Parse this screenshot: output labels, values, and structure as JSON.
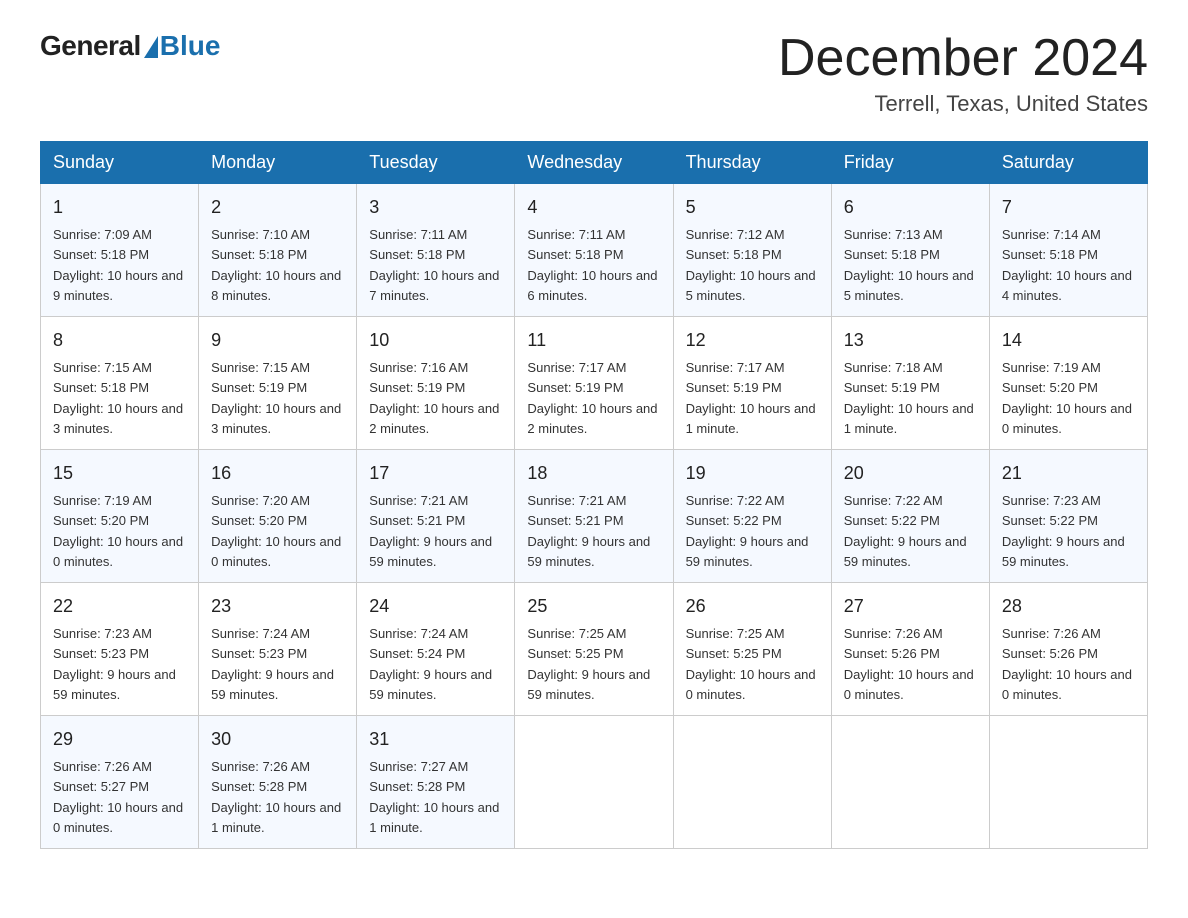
{
  "header": {
    "logo_general": "General",
    "logo_blue": "Blue",
    "month_title": "December 2024",
    "location": "Terrell, Texas, United States"
  },
  "weekdays": [
    "Sunday",
    "Monday",
    "Tuesday",
    "Wednesday",
    "Thursday",
    "Friday",
    "Saturday"
  ],
  "weeks": [
    [
      {
        "day": "1",
        "sunrise": "7:09 AM",
        "sunset": "5:18 PM",
        "daylight": "10 hours and 9 minutes."
      },
      {
        "day": "2",
        "sunrise": "7:10 AM",
        "sunset": "5:18 PM",
        "daylight": "10 hours and 8 minutes."
      },
      {
        "day": "3",
        "sunrise": "7:11 AM",
        "sunset": "5:18 PM",
        "daylight": "10 hours and 7 minutes."
      },
      {
        "day": "4",
        "sunrise": "7:11 AM",
        "sunset": "5:18 PM",
        "daylight": "10 hours and 6 minutes."
      },
      {
        "day": "5",
        "sunrise": "7:12 AM",
        "sunset": "5:18 PM",
        "daylight": "10 hours and 5 minutes."
      },
      {
        "day": "6",
        "sunrise": "7:13 AM",
        "sunset": "5:18 PM",
        "daylight": "10 hours and 5 minutes."
      },
      {
        "day": "7",
        "sunrise": "7:14 AM",
        "sunset": "5:18 PM",
        "daylight": "10 hours and 4 minutes."
      }
    ],
    [
      {
        "day": "8",
        "sunrise": "7:15 AM",
        "sunset": "5:18 PM",
        "daylight": "10 hours and 3 minutes."
      },
      {
        "day": "9",
        "sunrise": "7:15 AM",
        "sunset": "5:19 PM",
        "daylight": "10 hours and 3 minutes."
      },
      {
        "day": "10",
        "sunrise": "7:16 AM",
        "sunset": "5:19 PM",
        "daylight": "10 hours and 2 minutes."
      },
      {
        "day": "11",
        "sunrise": "7:17 AM",
        "sunset": "5:19 PM",
        "daylight": "10 hours and 2 minutes."
      },
      {
        "day": "12",
        "sunrise": "7:17 AM",
        "sunset": "5:19 PM",
        "daylight": "10 hours and 1 minute."
      },
      {
        "day": "13",
        "sunrise": "7:18 AM",
        "sunset": "5:19 PM",
        "daylight": "10 hours and 1 minute."
      },
      {
        "day": "14",
        "sunrise": "7:19 AM",
        "sunset": "5:20 PM",
        "daylight": "10 hours and 0 minutes."
      }
    ],
    [
      {
        "day": "15",
        "sunrise": "7:19 AM",
        "sunset": "5:20 PM",
        "daylight": "10 hours and 0 minutes."
      },
      {
        "day": "16",
        "sunrise": "7:20 AM",
        "sunset": "5:20 PM",
        "daylight": "10 hours and 0 minutes."
      },
      {
        "day": "17",
        "sunrise": "7:21 AM",
        "sunset": "5:21 PM",
        "daylight": "9 hours and 59 minutes."
      },
      {
        "day": "18",
        "sunrise": "7:21 AM",
        "sunset": "5:21 PM",
        "daylight": "9 hours and 59 minutes."
      },
      {
        "day": "19",
        "sunrise": "7:22 AM",
        "sunset": "5:22 PM",
        "daylight": "9 hours and 59 minutes."
      },
      {
        "day": "20",
        "sunrise": "7:22 AM",
        "sunset": "5:22 PM",
        "daylight": "9 hours and 59 minutes."
      },
      {
        "day": "21",
        "sunrise": "7:23 AM",
        "sunset": "5:22 PM",
        "daylight": "9 hours and 59 minutes."
      }
    ],
    [
      {
        "day": "22",
        "sunrise": "7:23 AM",
        "sunset": "5:23 PM",
        "daylight": "9 hours and 59 minutes."
      },
      {
        "day": "23",
        "sunrise": "7:24 AM",
        "sunset": "5:23 PM",
        "daylight": "9 hours and 59 minutes."
      },
      {
        "day": "24",
        "sunrise": "7:24 AM",
        "sunset": "5:24 PM",
        "daylight": "9 hours and 59 minutes."
      },
      {
        "day": "25",
        "sunrise": "7:25 AM",
        "sunset": "5:25 PM",
        "daylight": "9 hours and 59 minutes."
      },
      {
        "day": "26",
        "sunrise": "7:25 AM",
        "sunset": "5:25 PM",
        "daylight": "10 hours and 0 minutes."
      },
      {
        "day": "27",
        "sunrise": "7:26 AM",
        "sunset": "5:26 PM",
        "daylight": "10 hours and 0 minutes."
      },
      {
        "day": "28",
        "sunrise": "7:26 AM",
        "sunset": "5:26 PM",
        "daylight": "10 hours and 0 minutes."
      }
    ],
    [
      {
        "day": "29",
        "sunrise": "7:26 AM",
        "sunset": "5:27 PM",
        "daylight": "10 hours and 0 minutes."
      },
      {
        "day": "30",
        "sunrise": "7:26 AM",
        "sunset": "5:28 PM",
        "daylight": "10 hours and 1 minute."
      },
      {
        "day": "31",
        "sunrise": "7:27 AM",
        "sunset": "5:28 PM",
        "daylight": "10 hours and 1 minute."
      },
      null,
      null,
      null,
      null
    ]
  ],
  "labels": {
    "sunrise_prefix": "Sunrise: ",
    "sunset_prefix": "Sunset: ",
    "daylight_prefix": "Daylight: "
  }
}
